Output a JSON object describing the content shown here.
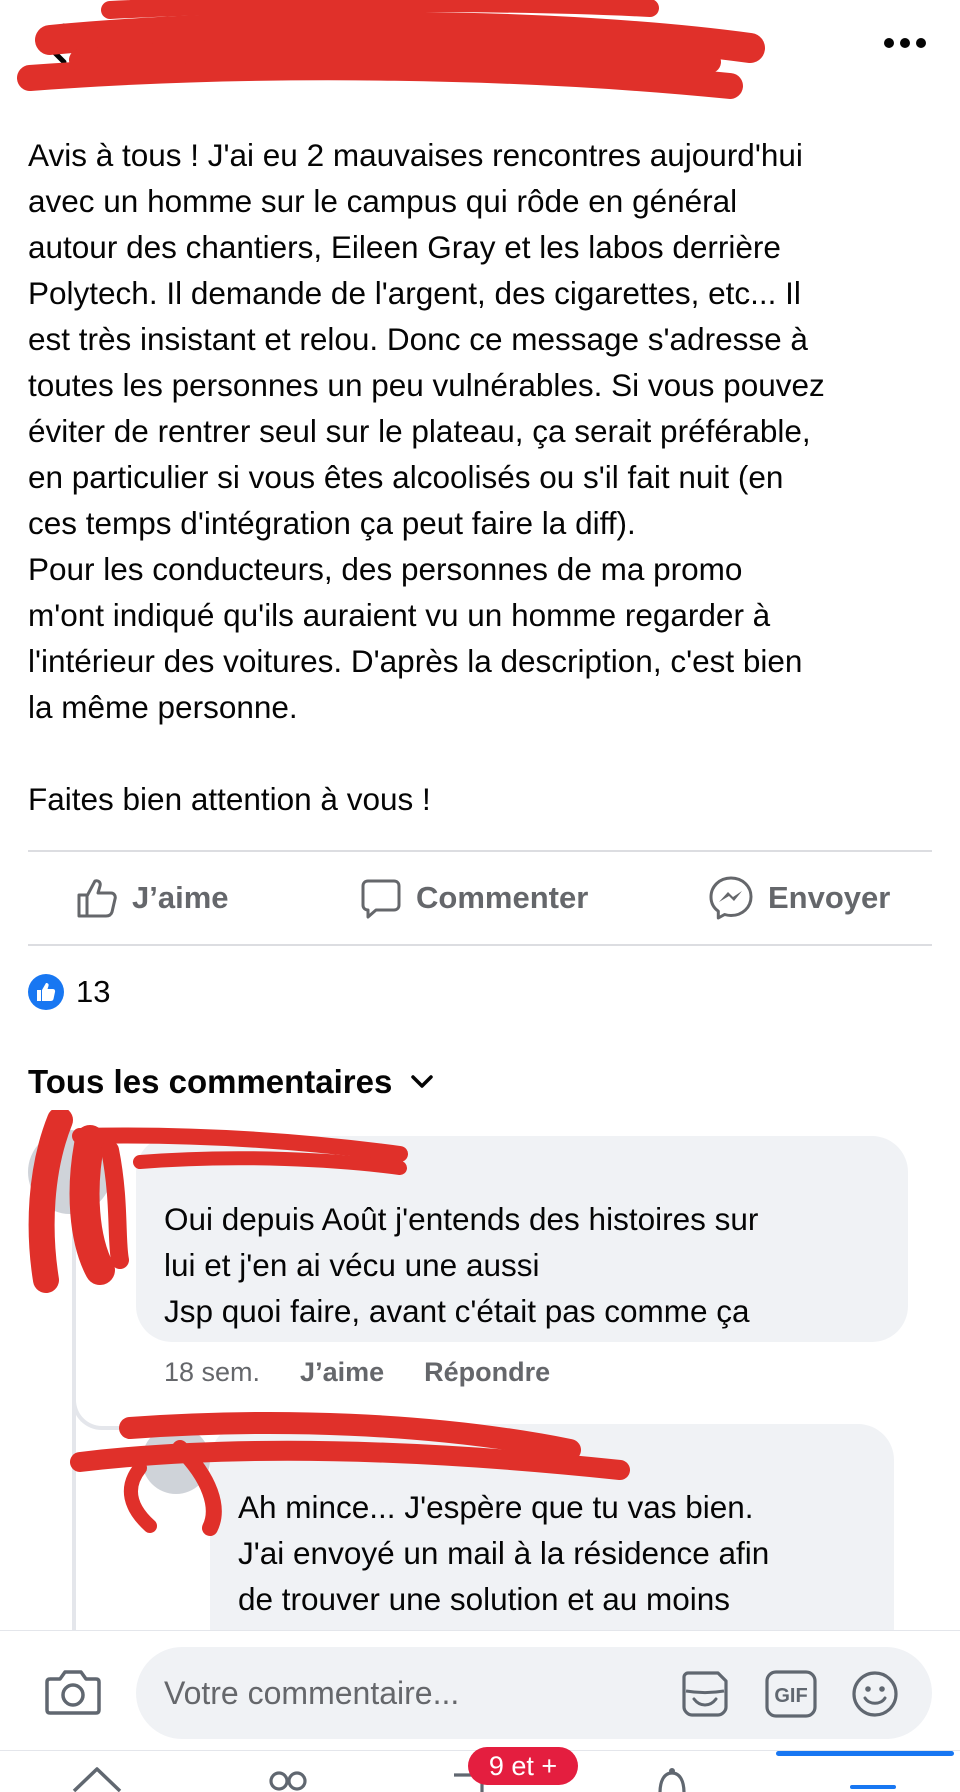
{
  "header": {
    "back_icon": "chevron-left-icon",
    "more_icon": "more-horizontal-icon"
  },
  "post": {
    "text": "Avis à tous ! J'ai eu 2 mauvaises rencontres aujourd'hui\navec un homme sur le campus qui rôde en général\nautour des chantiers, Eileen Gray et les labos derrière\nPolytech. Il demande de l'argent, des cigarettes, etc... Il\nest très insistant et relou. Donc ce message s'adresse à\ntoutes les personnes un peu vulnérables. Si vous pouvez\néviter de rentrer seul sur le plateau, ça serait préférable,\nen particulier si vous êtes alcoolisés ou s'il fait nuit (en\nces temps d'intégration ça peut faire la diff).\nPour les conducteurs, des personnes de ma promo\nm'ont indiqué qu'ils auraient vu un homme regarder à\nl'intérieur des voitures. D'après la description, c'est bien\nla même personne.\n\nFaites bien attention à vous !"
  },
  "actions": {
    "like_label": "J’aime",
    "comment_label": "Commenter",
    "send_label": "Envoyer"
  },
  "reactions": {
    "count": "13",
    "icon": "like-reaction-icon",
    "color": "#1877f2"
  },
  "comments_section": {
    "title": "Tous les commentaires"
  },
  "comments": [
    {
      "text": "Oui depuis Août j'entends des histoires sur\nlui et j'en ai vécu une aussi\nJsp quoi faire, avant c'était pas comme ça",
      "time": "18 sem.",
      "like_label": "J’aime",
      "reply_label": "Répondre"
    },
    {
      "text": "Ah mince... J'espère que tu vas bien.\nJ'ai envoyé un mail à la résidence afin\nde trouver une solution et au moins"
    }
  ],
  "composer": {
    "placeholder": "Votre commentaire...",
    "camera_icon": "camera-icon",
    "sticker_icon": "sticker-icon",
    "gif_label": "GIF",
    "emoji_icon": "emoji-icon"
  },
  "bottom_nav": {
    "badge": "9 et +",
    "active_color": "#1877f2",
    "badge_color": "#e41e3f"
  },
  "colors": {
    "text_primary": "#050505",
    "text_secondary": "#65676b",
    "bubble_bg": "#f0f2f5",
    "redaction": "#e0302a"
  }
}
